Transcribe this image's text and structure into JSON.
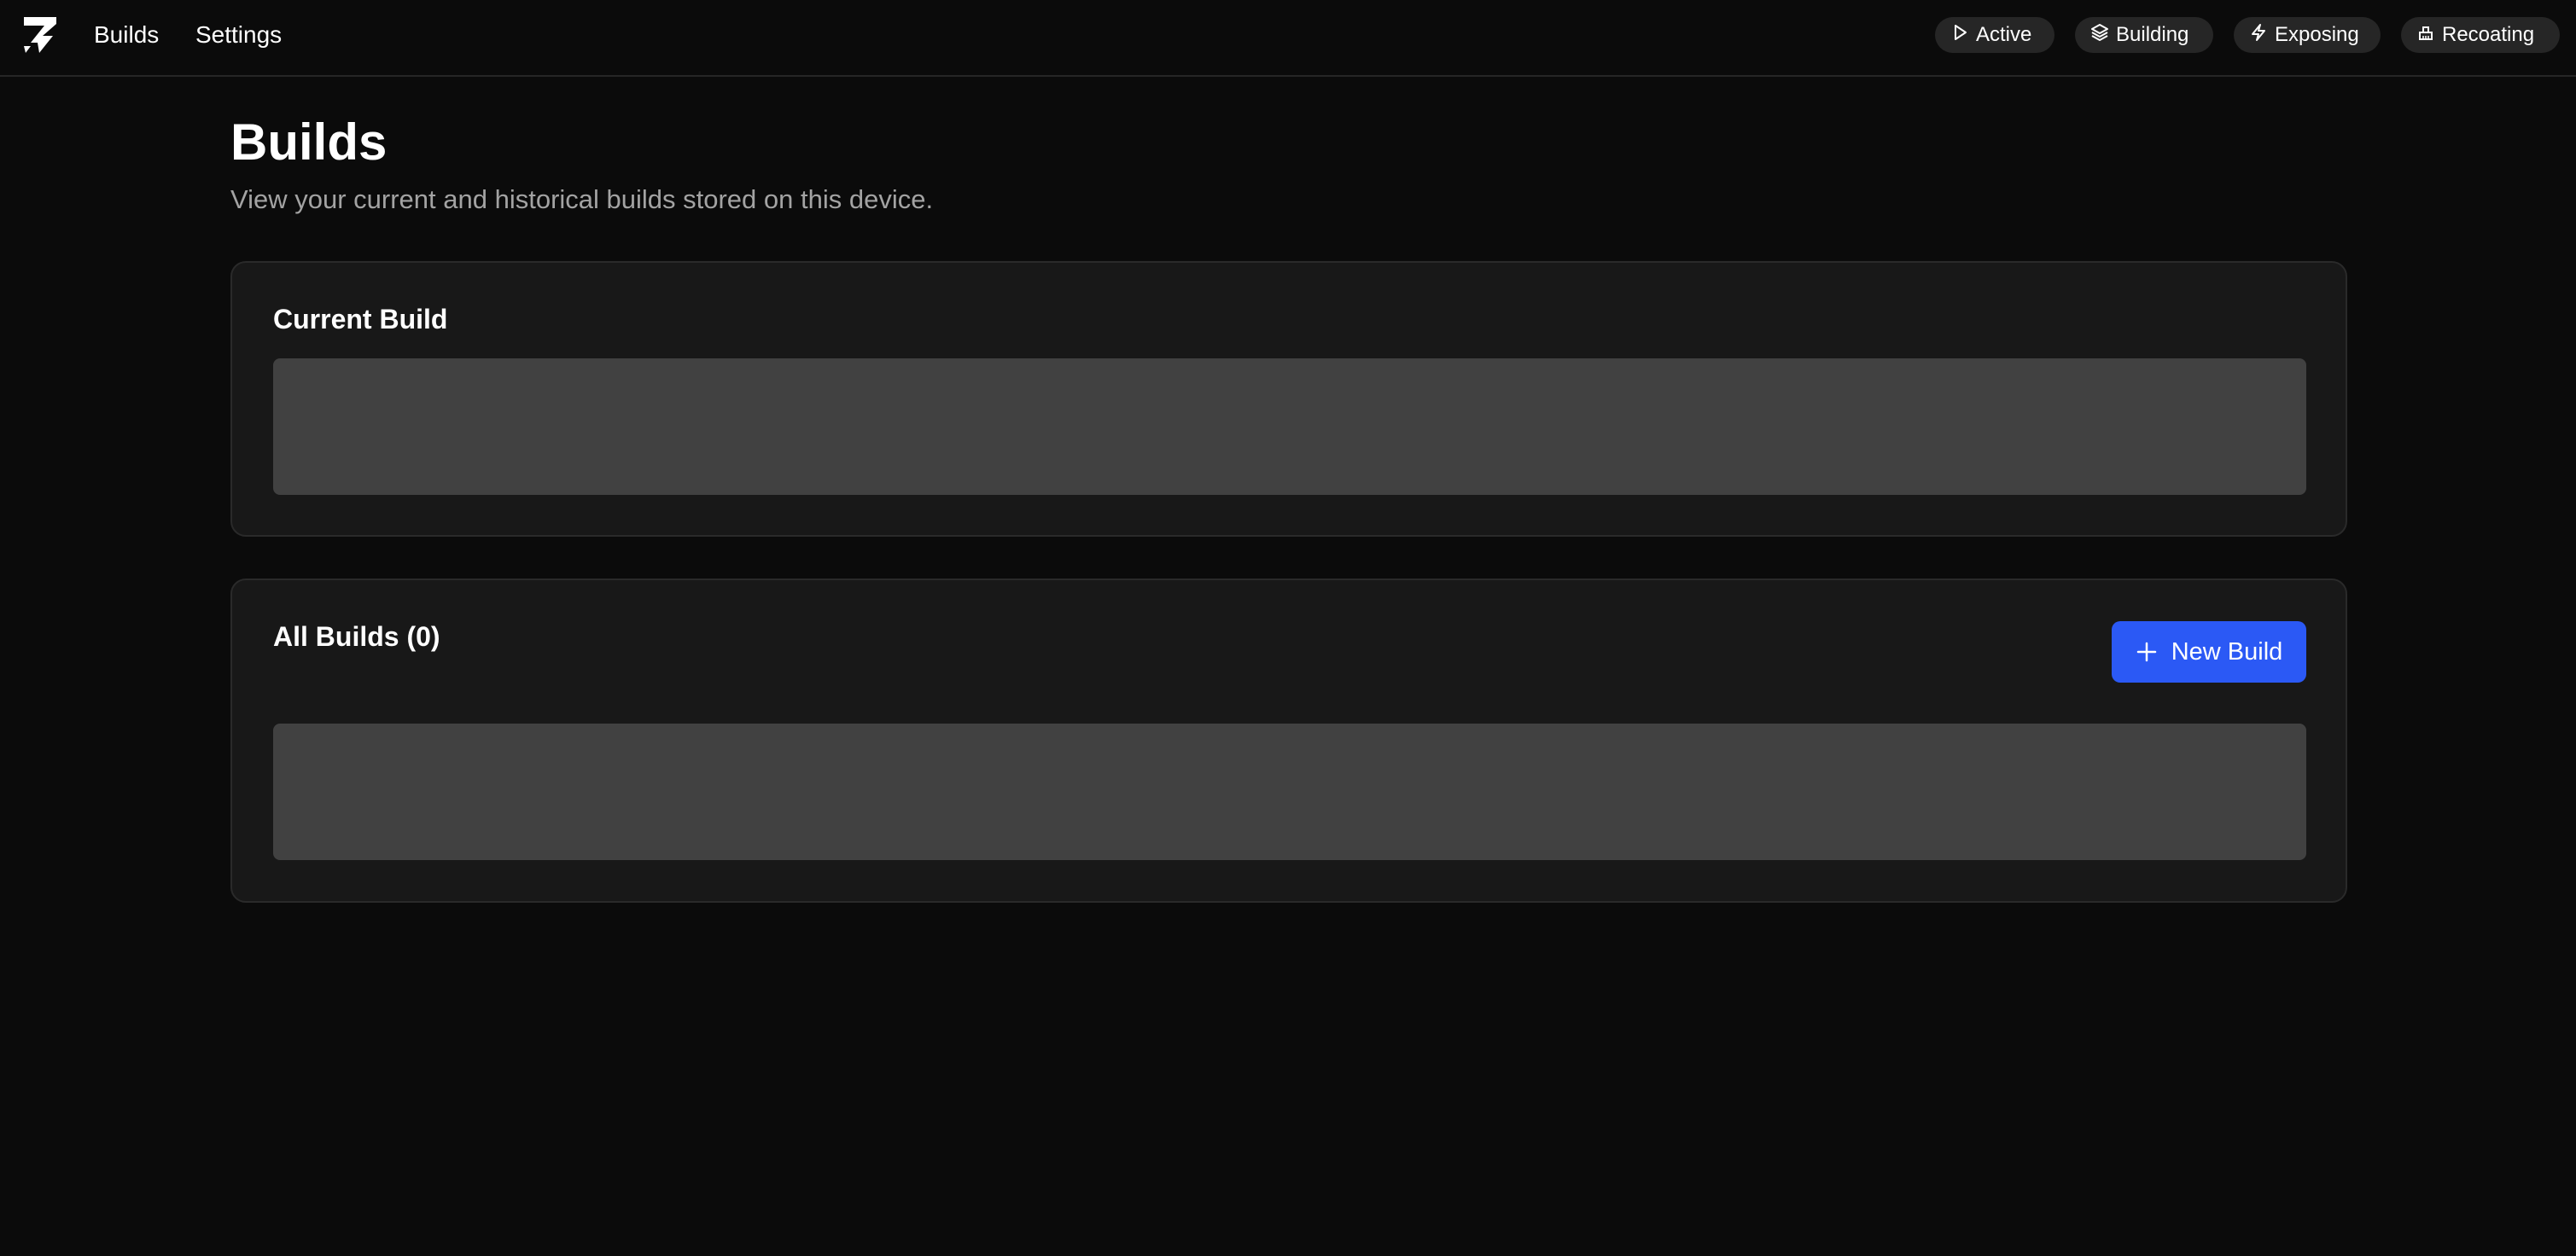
{
  "nav": {
    "logo_icon": "printer-logo-icon",
    "links": [
      {
        "label": "Builds"
      },
      {
        "label": "Settings"
      }
    ]
  },
  "status": [
    {
      "label": "Active",
      "icon": "play-icon"
    },
    {
      "label": "Building",
      "icon": "layers-icon"
    },
    {
      "label": "Exposing",
      "icon": "lightning-icon"
    },
    {
      "label": "Recoating",
      "icon": "brush-icon"
    }
  ],
  "page": {
    "title": "Builds",
    "subtitle": "View your current and historical builds stored on this device."
  },
  "current_build": {
    "title": "Current Build"
  },
  "all_builds": {
    "title": "All Builds (0)",
    "new_build_label": "New Build",
    "new_build_icon": "plus-icon"
  },
  "colors": {
    "background": "#0b0b0b",
    "card": "#181818",
    "placeholder": "#414141",
    "pill": "#262626",
    "accent": "#2b59f5",
    "muted_text": "#a3a3a3"
  }
}
